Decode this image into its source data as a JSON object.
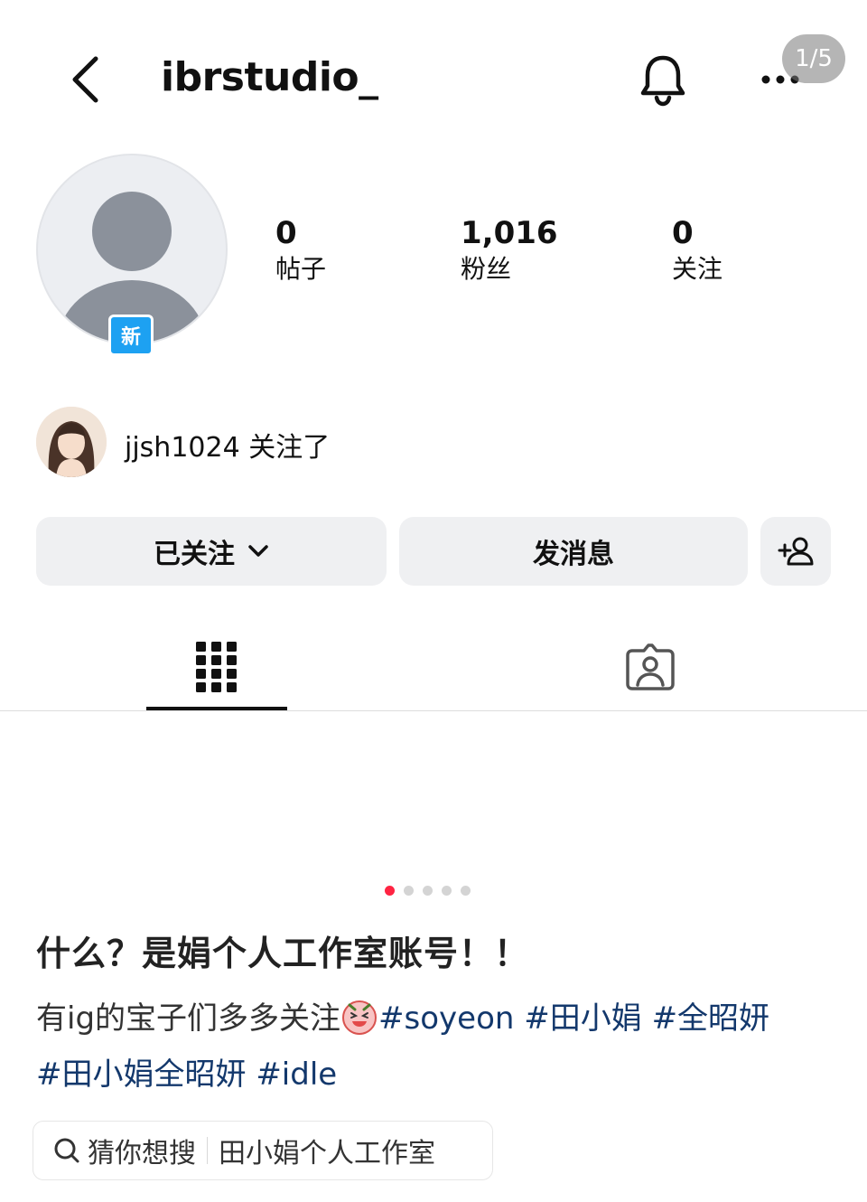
{
  "header": {
    "username": "ibrstudio_",
    "page_indicator": "1/5"
  },
  "profile": {
    "new_badge": "新",
    "stats": {
      "posts_value": "0",
      "posts_label": "帖子",
      "followers_value": "1,016",
      "followers_label": "粉丝",
      "following_value": "0",
      "following_label": "关注"
    },
    "followed_by": {
      "user": "jjsh1024",
      "suffix": " 关注了"
    }
  },
  "actions": {
    "following_label": "已关注",
    "message_label": "发消息"
  },
  "tabs": {
    "grid_icon": "grid-icon",
    "tagged_icon": "tagged-person-icon"
  },
  "carousel": {
    "count": 5,
    "active_index": 0,
    "active_color": "#ff2442"
  },
  "post": {
    "title": "什么？是娟个人工作室账号！！",
    "body_text": "有ig的宝子们多多关注",
    "tags": [
      "#soyeon",
      "#田小娟",
      "#全昭妍",
      "#田小娟全昭妍",
      "#idle"
    ]
  },
  "search": {
    "prefix": "猜你想搜",
    "query": "田小娟个人工作室"
  },
  "colors": {
    "tag": "#13386c",
    "button_bg": "#eff0f2",
    "badge_blue": "#1da1f2"
  }
}
